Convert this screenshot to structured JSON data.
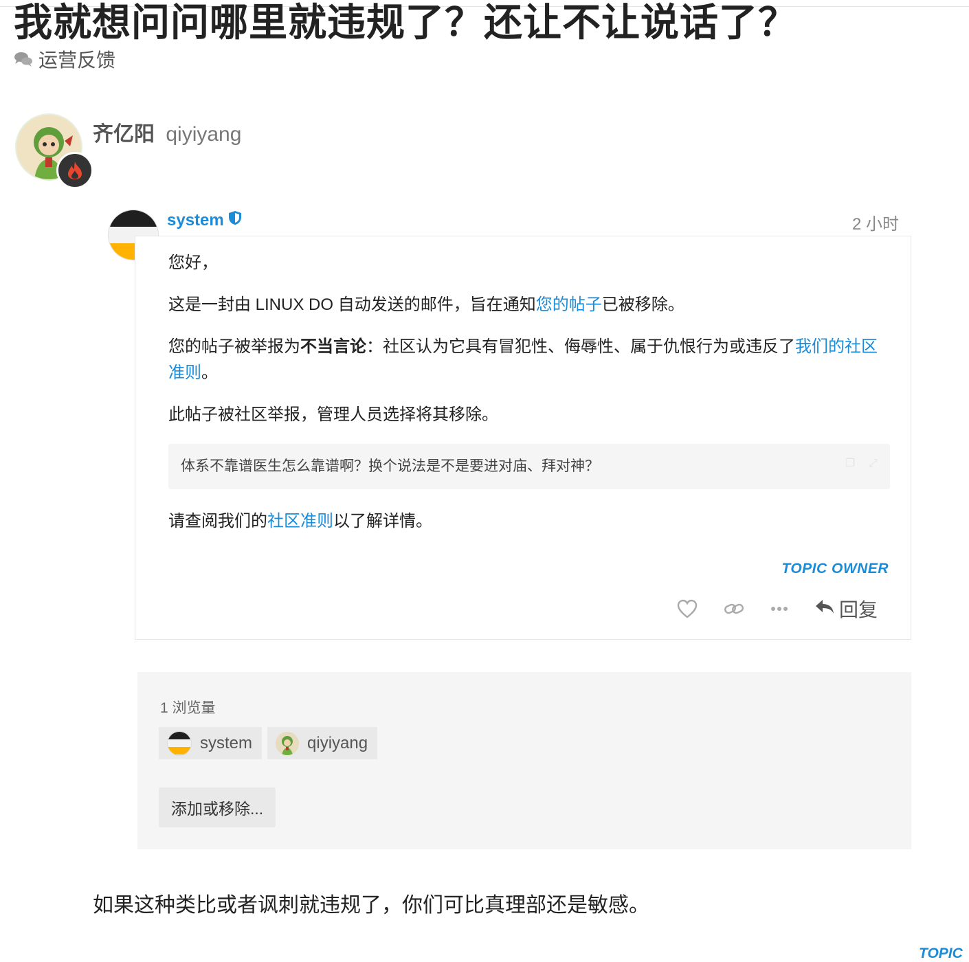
{
  "topic": {
    "title": "我就想问问哪里就违规了？还让不让说话了？",
    "category": "运营反馈"
  },
  "post": {
    "display_name": "齐亿阳",
    "username": "qiyiyang",
    "reply_text": "如果这种类比或者讽刺就违规了，你们可比真理部还是敏感。",
    "bottom_tag": "TOPIC"
  },
  "system_message": {
    "author": "system",
    "date": "2 小时",
    "greeting": "您好，",
    "p1_before": "这是一封由 LINUX DO 自动发送的邮件，旨在通知",
    "p1_link": "您的帖子",
    "p1_after": "已被移除。",
    "p2_before": "您的帖子被举报为",
    "p2_bold": "不当言论",
    "p2_mid": "：社区认为它具有冒犯性、侮辱性、属于仇恨行为或违反了",
    "p2_link": "我们的社区准则",
    "p2_after": "。",
    "p3": "此帖子被社区举报，管理人员选择将其移除。",
    "quote": "体系不靠谱医生怎么靠谱啊？换个说法是不是要进对庙、拜对神？",
    "p4_before": "请查阅我们的",
    "p4_link": "社区准则",
    "p4_after": "以了解详情。",
    "owner_tag": "TOPIC OWNER",
    "reply_label": "回复"
  },
  "views": {
    "count_label": "1 浏览量",
    "participants": [
      "system",
      "qiyiyang"
    ],
    "add_button": "添加或移除..."
  },
  "colors": {
    "accent": "#1a8cd8",
    "system_avatar": [
      "#1f1f1f",
      "#f2f2f2",
      "#ffb300"
    ],
    "panel_bg": "#f5f5f5"
  }
}
